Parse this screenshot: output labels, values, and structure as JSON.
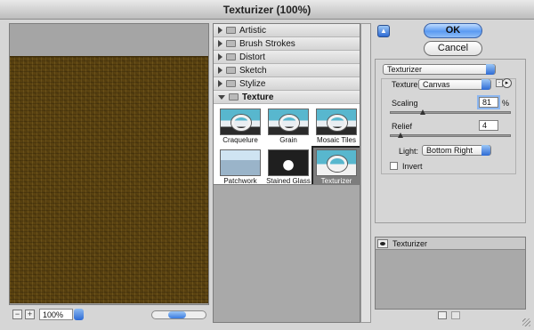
{
  "window": {
    "title": "Texturizer (100%)"
  },
  "preview": {
    "zoom_value": "100%",
    "zoom_out": "−",
    "zoom_in": "+"
  },
  "gallery": {
    "categories": [
      {
        "label": "Artistic"
      },
      {
        "label": "Brush Strokes"
      },
      {
        "label": "Distort"
      },
      {
        "label": "Sketch"
      },
      {
        "label": "Stylize"
      },
      {
        "label": "Texture"
      }
    ],
    "texture_filters": [
      {
        "label": "Craquelure"
      },
      {
        "label": "Grain"
      },
      {
        "label": "Mosaic Tiles"
      },
      {
        "label": "Patchwork"
      },
      {
        "label": "Stained Glass"
      },
      {
        "label": "Texturizer"
      }
    ]
  },
  "buttons": {
    "ok": "OK",
    "cancel": "Cancel"
  },
  "settings": {
    "filter_select": "Texturizer",
    "texture_label": "Texture:",
    "texture_select": "Canvas",
    "scaling_label": "Scaling",
    "scaling_value": "81",
    "scaling_unit": "%",
    "scaling_fraction": 0.27,
    "relief_label": "Relief",
    "relief_value": "4",
    "relief_fraction": 0.08,
    "light_label": "Light:",
    "light_select": "Bottom Right",
    "invert_label": "Invert",
    "invert_checked": false
  },
  "layers": {
    "items": [
      {
        "label": "Texturizer"
      }
    ]
  },
  "colors": {
    "accent": "#2d6ad4",
    "preview_texture": "#5a4210"
  }
}
